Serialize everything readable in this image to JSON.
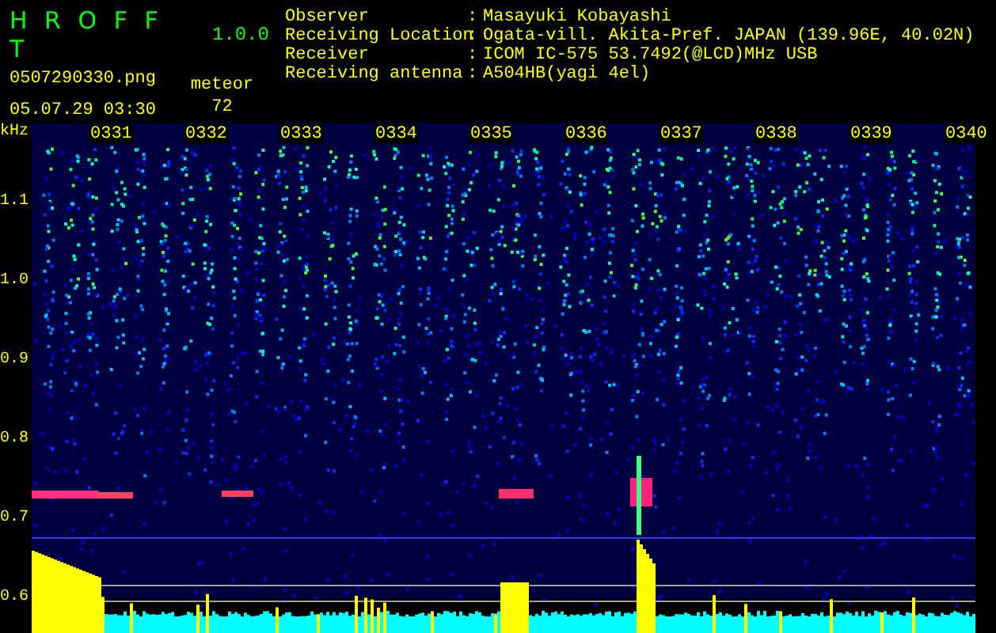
{
  "header": {
    "app_title": "H R O F F T",
    "version": "1.0.0",
    "filename": "0507290330.png",
    "datetime": "05.07.29 03:30",
    "meteor_label": "meteor",
    "meteor_count": "72"
  },
  "info": [
    {
      "label": "Observer",
      "separator": ":",
      "value": "Masayuki Kobayashi"
    },
    {
      "label": "Receiving Location",
      "separator": ":",
      "value": "Ogata-vill. Akita-Pref. JAPAN (139.96E, 40.02N)"
    },
    {
      "label": "Receiver",
      "separator": ":",
      "value": "ICOM IC-575 53.7492(@LCD)MHz USB"
    },
    {
      "label": "Receiving antenna",
      "separator": ":",
      "value": "A504HB(yagi 4el)"
    }
  ],
  "axis": {
    "unit": "kHz",
    "frequency_labels": [
      "1.1",
      "1.0",
      "0.9",
      "0.8",
      "0.7",
      "0.6"
    ],
    "time_labels": [
      "0331",
      "0332",
      "0333",
      "0334",
      "0335",
      "0336",
      "0337",
      "0338",
      "0339",
      "0340"
    ]
  }
}
